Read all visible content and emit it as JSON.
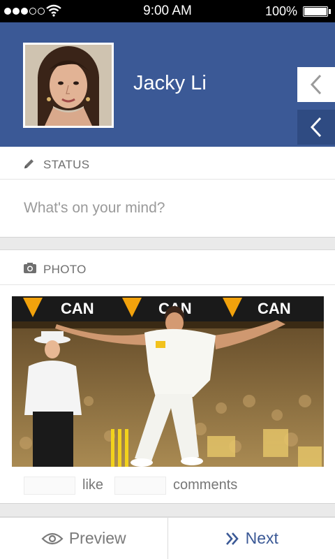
{
  "status_bar": {
    "time": "9:00 AM",
    "battery": "100%",
    "signal_bars_filled": 3,
    "signal_bars_total": 5
  },
  "profile": {
    "name": "Jacky Li"
  },
  "status_section": {
    "icon": "pencil-icon",
    "label": "STATUS",
    "placeholder": "What's on your mind?"
  },
  "photo_section": {
    "icon": "camera-icon",
    "label": "PHOTO",
    "banner_text": "CAN"
  },
  "engagement": {
    "like_label": "like",
    "comments_label": "comments"
  },
  "bottom_bar": {
    "preview_label": "Preview",
    "preview_icon": "eye-icon",
    "next_label": "Next",
    "next_icon": "double-chevron-right-icon"
  },
  "colors": {
    "brand": "#3b5996",
    "brand_dark": "#2f4b82"
  }
}
